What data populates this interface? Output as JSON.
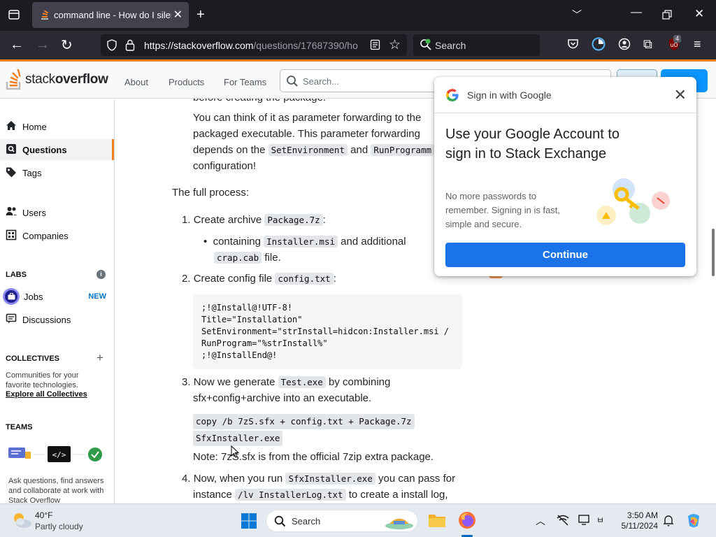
{
  "browser": {
    "tab_title": "command line - How do I silent",
    "url_main": "https://stackoverflow.com",
    "url_rest": "/questions/17687390/ho",
    "search_label": "Search",
    "extension_badge": "4"
  },
  "so_header": {
    "logo_stack": "stack",
    "logo_overflow": "overflow",
    "nav": [
      "About",
      "Products",
      "For Teams"
    ],
    "search_placeholder": "Search..."
  },
  "sidebar": {
    "home": "Home",
    "questions": "Questions",
    "tags": "Tags",
    "users": "Users",
    "companies": "Companies",
    "labs_heading": "LABS",
    "jobs": "Jobs",
    "jobs_badge": "NEW",
    "discussions": "Discussions",
    "collectives_heading": "COLLECTIVES",
    "collectives_text": "Communities for your favorite technologies.",
    "collectives_link": "Explore all Collectives",
    "teams_heading": "TEAMS",
    "teams_text": "Ask questions, find answers and collaborate at work with Stack Overflow"
  },
  "content": {
    "cut_line": "before creating the package.",
    "param_a": "You can think of it as parameter forwarding to the",
    "param_b": "packaged executable. This parameter forwarding",
    "param_c1": "depends on the",
    "param_code1": "SetEnvironment",
    "param_c2": "and",
    "param_code2": "RunProgramm",
    "param_d": "configuration!",
    "full_process": "The full process:",
    "step1_num": "1.",
    "step1_a": "Create archive",
    "step1_code": "Package.7z",
    "step1_b": ":",
    "bullet_a": "containing",
    "bullet_code1": "Installer.msi",
    "bullet_b": "and additional",
    "bullet_code2": "crap.cab",
    "bullet_c": "file.",
    "step2_num": "2.",
    "step2_a": "Create config file",
    "step2_code": "config.txt",
    "step2_b": ":",
    "code_block": ";!@Install@!UTF-8!\nTitle=\"Installation\"\nSetEnvironment=\"strInstall=hidcon:Installer.msi /\nRunProgram=\"%strInstall%\"\n;!@InstallEnd@!",
    "step3_num": "3.",
    "step3_a": "Now we generate",
    "step3_code": "Test.exe",
    "step3_b": "by combining",
    "step3_c": "sfx+config+archive into an executable.",
    "cmd_line1": "copy /b 7zS.sfx + config.txt + Package.7z",
    "cmd_line2": "SfxInstaller.exe",
    "note": "Note: 7zS.sfx is from the official 7zip extra package.",
    "step4_num": "4.",
    "step4_a": "Now, when you run",
    "step4_code1": "SfxInstaller.exe",
    "step4_b": "you can pass for",
    "step4_c": "instance",
    "step4_code2": "/lv InstallerLog.txt",
    "step4_d": "to create a install log,"
  },
  "google_popup": {
    "header": "Sign in with Google",
    "heading": "Use your Google Account to sign in to Stack Exchange",
    "sub": "No more passwords to remember. Signing in is fast, simple and secure.",
    "button": "Continue"
  },
  "taskbar": {
    "temp": "40°F",
    "weather": "Partly cloudy",
    "search": "Search",
    "time": "3:50 AM",
    "date": "5/11/2024"
  },
  "colors": {
    "so_orange": "#f48024",
    "google_blue": "#1a73e8",
    "link_blue": "#0074cc"
  }
}
